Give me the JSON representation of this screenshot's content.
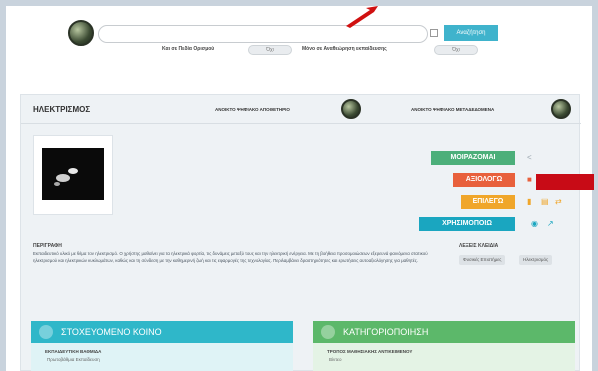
{
  "search": {
    "placeholder": "",
    "button_label": "Αναζήτηση",
    "filter1_label": "Και σε Πεδία Ορισμού",
    "filter1_value": "Όχι",
    "filter2_label": "Μόνο σε Αναθεώρηση εκπαίδευσης",
    "filter2_value": "Όχι"
  },
  "resource": {
    "title": "ΗΛΕΚΤΡΙΣΜΟΣ",
    "header_link1": "ΑΝΟΙΚΤΟ ΨΗΦΙΑΚΟ ΑΠΟΘΕΤΗΡΙΟ",
    "header_link2": "ΑΝΟΙΚΤΟ ΨΗΦΙΑΚΟ ΜΕΤΑΔΕΔΟΜΕΝΑ",
    "actions": [
      {
        "label": "ΜΟΙΡΑΖΟΜΑΙ",
        "color": "#4caf7a"
      },
      {
        "label": "ΑΞΙΟΛΟΓΩ",
        "color": "#e8603c"
      },
      {
        "label": "ΕΠΙΛΕΓΩ",
        "color": "#f0a62a"
      },
      {
        "label": "ΧΡΗΣΙΜΟΠΟΙΩ",
        "color": "#1aa6c0"
      }
    ],
    "description_heading": "ΠΕΡΙΓΡΑΦΗ",
    "description_text": "Εκπαιδευτικό υλικό με θέμα τον ηλεκτρισμό. Ο χρήστης μαθαίνει για τα ηλεκτρικά φορτία, τις δυνάμεις μεταξύ τους και την ηλεκτρική ενέργεια. Με τη βοήθεια προσομοιώσεων εξερευνά φαινόμενα στατικού ηλεκτρισμού και ηλεκτρικών κυκλωμάτων, καθώς και τη σύνδεση με την καθημερινή ζωή και τις εφαρμογές της τεχνολογίας. Περιλαμβάνει δραστηριότητες και ερωτήσεις αυτοαξιολόγησης για μαθητές.",
    "meta_heading": "ΛΕΞΕΙΣ ΚΛΕΙΔΙΑ",
    "tags": [
      "Φυσικές Επιστήμες",
      "Ηλεκτρισμός"
    ]
  },
  "sections": [
    {
      "title": "ΣΤΟΧΕΥΟΜΕΝΟ ΚΟΙΝΟ",
      "color": "#2fb7c9",
      "sub": "ΕΚΠΑΙΔΕΥΤΙΚΗ ΒΑΘΜΙΔΑ",
      "sub2": "Πρωτοβάθμια Εκπαίδευση"
    },
    {
      "title": "ΚΑΤΗΓΟΡΙΟΠΟΙΗΣΗ",
      "color": "#5cb86a",
      "sub": "ΤΡΟΠΟΣ ΜΑΘΗΣΙΑΚΗΣ ΑΝΤΙΚΕΙΜΕΝΟΥ",
      "sub2": "Βίντεο"
    }
  ],
  "colors": {
    "accent_blue": "#3fb3cc",
    "arrow_red": "#d01010",
    "annotation_red": "#c80b16"
  },
  "icons": [
    "globe-logo-icon",
    "share-icon",
    "comment-icon",
    "star-icon",
    "flag-icon",
    "bookmark-icon",
    "folder-icon",
    "link-icon",
    "eye-icon",
    "external-link-icon",
    "target-audience-icon",
    "category-icon"
  ]
}
